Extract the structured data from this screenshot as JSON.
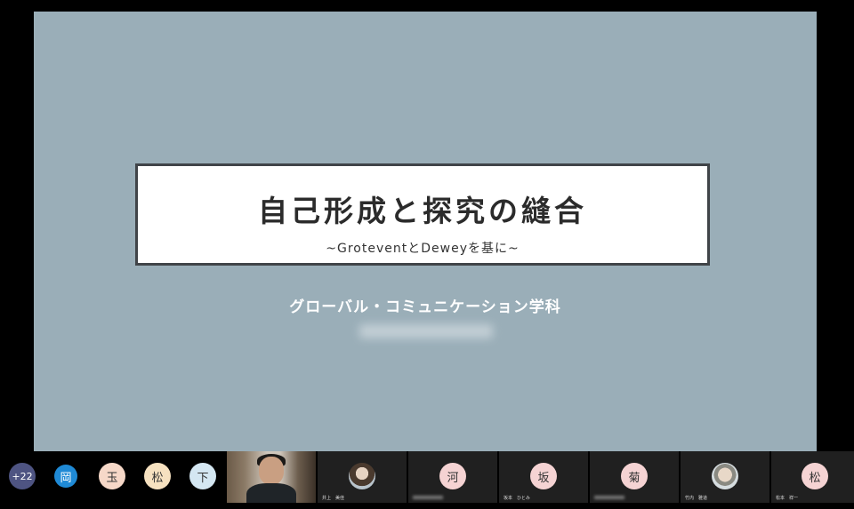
{
  "slide": {
    "title": "自己形成と探究の縫合",
    "subtitle": "~GroteventとDeweyを基に~",
    "department": "グローバル・コミュニケーション学科"
  },
  "participants": {
    "more_count": "+22",
    "avatars": [
      {
        "initial": "岡",
        "color": "#1f8ad6"
      },
      {
        "initial": "玉",
        "color": "#f6d8c8"
      },
      {
        "initial": "松",
        "color": "#f6e1c0"
      },
      {
        "initial": "下",
        "color": "#d4e7f2"
      }
    ],
    "tiles": [
      {
        "name": "井上　美佳",
        "initial": ""
      },
      {
        "name": "",
        "initial": "河",
        "color": "#f5d3d3"
      },
      {
        "name": "坂本　ひとみ",
        "initial": "坂",
        "color": "#f5d3d3"
      },
      {
        "name": "",
        "initial": "菊",
        "color": "#f5d3d3"
      },
      {
        "name": "竹内　雅道",
        "initial": ""
      },
      {
        "name": "松本　祥一",
        "initial": "松",
        "color": "#f5d3d3"
      }
    ]
  }
}
